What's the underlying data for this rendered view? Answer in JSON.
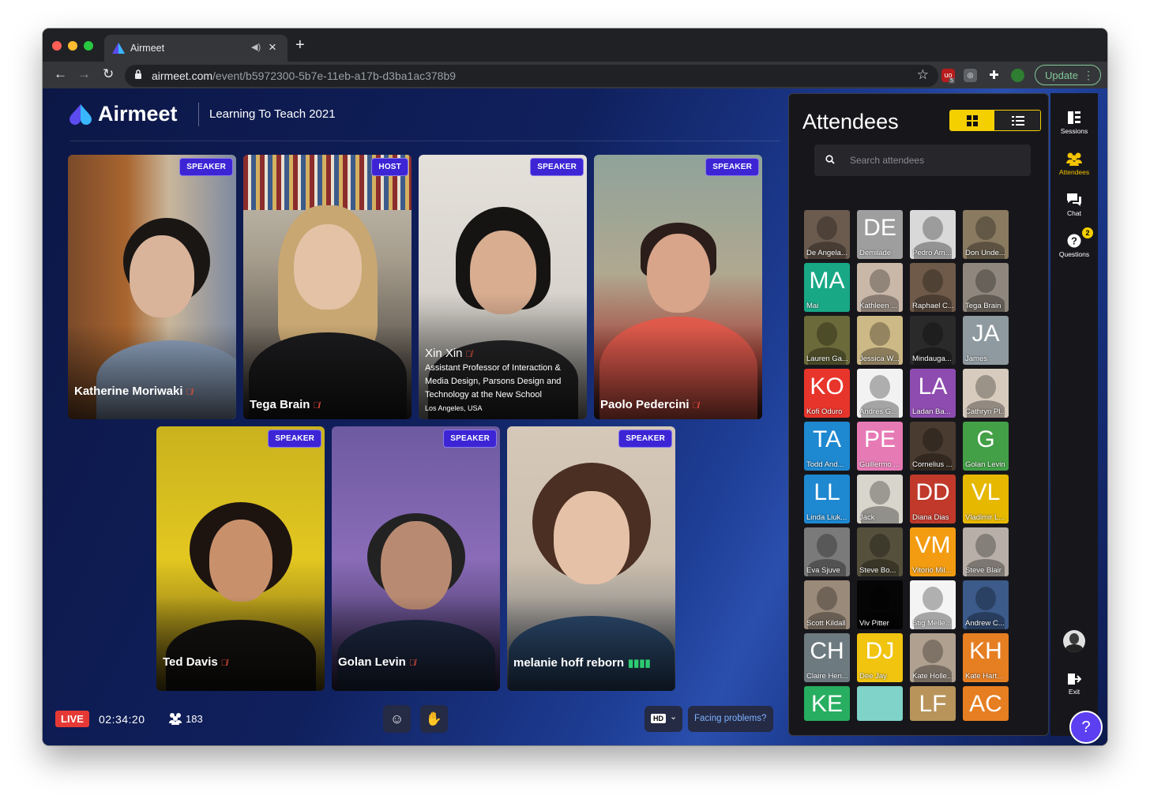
{
  "browser": {
    "tab_title": "Airmeet",
    "url_host": "airmeet.com",
    "url_path": "/event/b5972300-5b7e-11eb-a17b-d3ba1ac378b9",
    "update_label": "Update",
    "extension_badge": "5"
  },
  "header": {
    "brand": "Airmeet",
    "event_name": "Learning To Teach 2021"
  },
  "stage": {
    "tiles": [
      {
        "name": "Katherine Moriwaki",
        "role": "SPEAKER",
        "muted": true
      },
      {
        "name": "Tega Brain",
        "role": "HOST",
        "muted": true
      },
      {
        "name": "Xin Xin",
        "role": "SPEAKER",
        "muted": true,
        "bio_lines": [
          "Assistant Professor of Interaction &",
          "Media Design, Parsons Design and",
          "Technology at the New School"
        ],
        "location": "Los Angeles, USA"
      },
      {
        "name": "Paolo Pedercini",
        "role": "SPEAKER",
        "muted": true
      },
      {
        "name": "Ted Davis",
        "role": "SPEAKER",
        "muted": true
      },
      {
        "name": "Golan Levin",
        "role": "SPEAKER",
        "muted": true
      },
      {
        "name": "melanie hoff reborn",
        "role": "SPEAKER",
        "muted": false,
        "speaking": true
      }
    ]
  },
  "bottom_bar": {
    "live_label": "LIVE",
    "elapsed": "02:34:20",
    "attendee_count": "183",
    "quality_label": "HD",
    "help_link": "Facing problems?"
  },
  "attendees_panel": {
    "title": "Attendees",
    "search_placeholder": "Search attendees",
    "view_mode": "grid",
    "attendees": [
      {
        "label": "De Angela...",
        "initials": "",
        "color": "#6b5b4e"
      },
      {
        "label": "Demilade",
        "initials": "DE",
        "color": "#9e9e9e"
      },
      {
        "label": "Pedro Am...",
        "initials": "",
        "color": "#d9d9d9"
      },
      {
        "label": "Don Unde...",
        "initials": "",
        "color": "#8a7a60"
      },
      {
        "label": "Mai",
        "initials": "MA",
        "color": "#18a886"
      },
      {
        "label": "Kathleen ...",
        "initials": "",
        "color": "#c9b7a8"
      },
      {
        "label": "Raphael C...",
        "initials": "",
        "color": "#6f5a4a"
      },
      {
        "label": "Tega Brain",
        "initials": "",
        "color": "#8f877d"
      },
      {
        "label": "Lauren Ga...",
        "initials": "",
        "color": "#6b6a3a"
      },
      {
        "label": "Jessica W...",
        "initials": "",
        "color": "#cdb986"
      },
      {
        "label": "Mindauga...",
        "initials": "",
        "color": "#2a2a2a"
      },
      {
        "label": "James",
        "initials": "JA",
        "color": "#8e9aa0"
      },
      {
        "label": "Kofi Oduro",
        "initials": "KO",
        "color": "#e8352c"
      },
      {
        "label": "Andres G...",
        "initials": "",
        "color": "#f2f2f2"
      },
      {
        "label": "Ladan Ba...",
        "initials": "LA",
        "color": "#8e4bb0"
      },
      {
        "label": "Cathryn Pl...",
        "initials": "",
        "color": "#d7cbbd"
      },
      {
        "label": "Todd And...",
        "initials": "TA",
        "color": "#1e88d0"
      },
      {
        "label": "Guillermo ...",
        "initials": "PE",
        "color": "#e67ab5"
      },
      {
        "label": "Cornelius ...",
        "initials": "",
        "color": "#4a3b30"
      },
      {
        "label": "Golan Levin",
        "initials": "G",
        "color": "#43a047"
      },
      {
        "label": "Linda Liuk...",
        "initials": "LL",
        "color": "#1e88d0"
      },
      {
        "label": "Jack",
        "initials": "",
        "color": "#d8d5cc"
      },
      {
        "label": "Diana Dias",
        "initials": "DD",
        "color": "#c0392b"
      },
      {
        "label": "Vladimir L...",
        "initials": "VL",
        "color": "#e6b800"
      },
      {
        "label": "Eva Sjuve",
        "initials": "",
        "color": "#7a7a7a"
      },
      {
        "label": "Steve Bo...",
        "initials": "",
        "color": "#55503c"
      },
      {
        "label": "Vitorio Mil...",
        "initials": "VM",
        "color": "#f39c12"
      },
      {
        "label": "Steve Blair",
        "initials": "",
        "color": "#b8b0a8"
      },
      {
        "label": "Scott Kildall",
        "initials": "",
        "color": "#9a8a7a"
      },
      {
        "label": "Viv Pitter",
        "initials": "",
        "color": "#050505"
      },
      {
        "label": "Stig Melle...",
        "initials": "",
        "color": "#f4f4f4"
      },
      {
        "label": "Andrew C...",
        "initials": "",
        "color": "#3c5a8a"
      },
      {
        "label": "Claire Hen...",
        "initials": "CH",
        "color": "#6d7a80"
      },
      {
        "label": "Dee Jay",
        "initials": "DJ",
        "color": "#f1c40f"
      },
      {
        "label": "Kate Holle...",
        "initials": "",
        "color": "#b0a090"
      },
      {
        "label": "Kate Hart...",
        "initials": "KH",
        "color": "#e67e22"
      },
      {
        "label": "",
        "initials": "KE",
        "color": "#27ae60"
      },
      {
        "label": "",
        "initials": "",
        "color": "#7fd3c8"
      },
      {
        "label": "",
        "initials": "LF",
        "color": "#b8945a"
      },
      {
        "label": "",
        "initials": "AC",
        "color": "#e67e22"
      }
    ]
  },
  "rail": {
    "sessions": "Sessions",
    "attendees": "Attendees",
    "chat": "Chat",
    "questions": "Questions",
    "questions_badge": "2",
    "exit": "Exit"
  }
}
